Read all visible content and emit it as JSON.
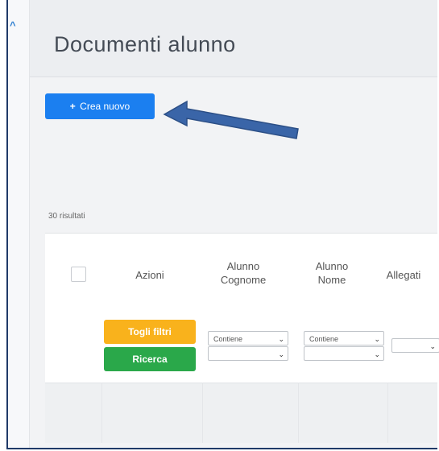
{
  "page": {
    "title": "Documenti alunno",
    "left_glyph": "^"
  },
  "actions": {
    "create_plus": "+",
    "create_label": "Crea nuovo"
  },
  "results": {
    "count_text": "30 risultati"
  },
  "table": {
    "columns": [
      {
        "label": "Azioni"
      },
      {
        "label": "Alunno Cognome",
        "line1": "Alunno",
        "line2": "Cognome"
      },
      {
        "label": "Alunno Nome",
        "line1": "Alunno",
        "line2": "Nome"
      },
      {
        "label": "Allegati"
      }
    ],
    "filters": {
      "clear_label": "Togli filtri",
      "search_label": "Ricerca",
      "cognome_operator": "Contiene",
      "nome_operator": "Contiene",
      "cognome_value": "",
      "nome_value": "",
      "allegati_value": ""
    }
  },
  "colors": {
    "primary": "#1b7ff0",
    "warning": "#f9b21c",
    "success": "#2aa84a",
    "arrow": "#3a65a8"
  },
  "icons": {
    "chevron": "chevron-down-icon",
    "arrow": "arrow-left-icon"
  }
}
